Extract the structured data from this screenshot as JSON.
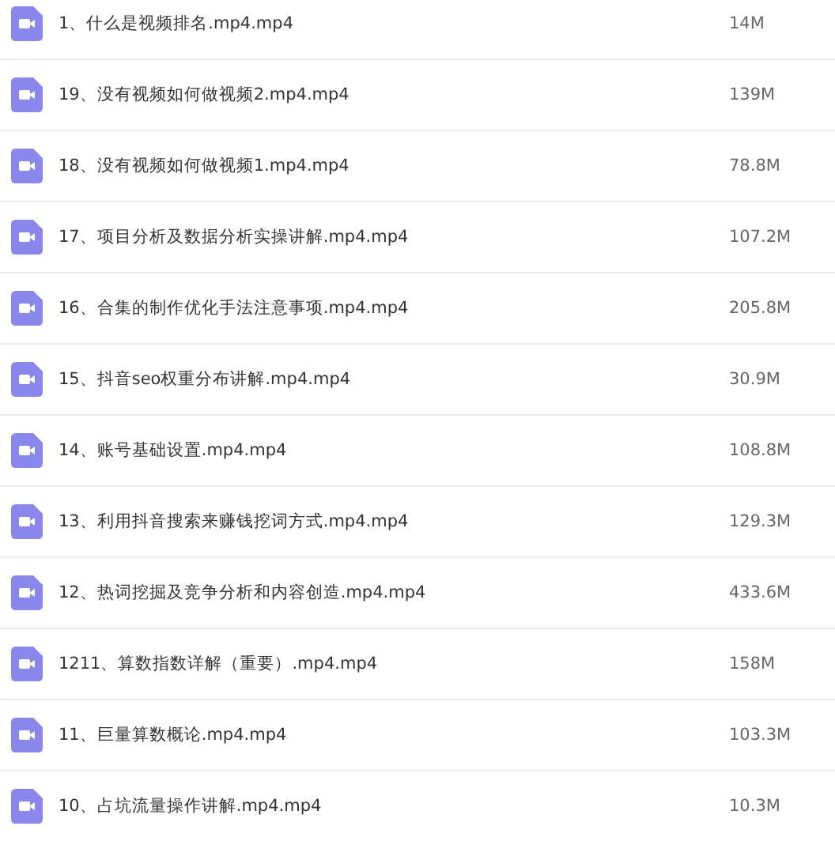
{
  "files": [
    {
      "name": "1、什么是视频排名.mp4.mp4",
      "size": "14M"
    },
    {
      "name": "19、没有视频如何做视频2.mp4.mp4",
      "size": "139M"
    },
    {
      "name": "18、没有视频如何做视频1.mp4.mp4",
      "size": "78.8M"
    },
    {
      "name": "17、项目分析及数据分析实操讲解.mp4.mp4",
      "size": "107.2M"
    },
    {
      "name": "16、合集的制作优化手法注意事项.mp4.mp4",
      "size": "205.8M"
    },
    {
      "name": "15、抖音seo权重分布讲解.mp4.mp4",
      "size": "30.9M"
    },
    {
      "name": "14、账号基础设置.mp4.mp4",
      "size": "108.8M"
    },
    {
      "name": "13、利用抖音搜索来赚钱挖词方式.mp4.mp4",
      "size": "129.3M"
    },
    {
      "name": "12、热词挖掘及竞争分析和内容创造.mp4.mp4",
      "size": "433.6M"
    },
    {
      "name": "1211、算数指数详解（重要）.mp4.mp4",
      "size": "158M"
    },
    {
      "name": "11、巨量算数概论.mp4.mp4",
      "size": "103.3M"
    },
    {
      "name": "10、占坑流量操作讲解.mp4.mp4",
      "size": "10.3M"
    }
  ]
}
